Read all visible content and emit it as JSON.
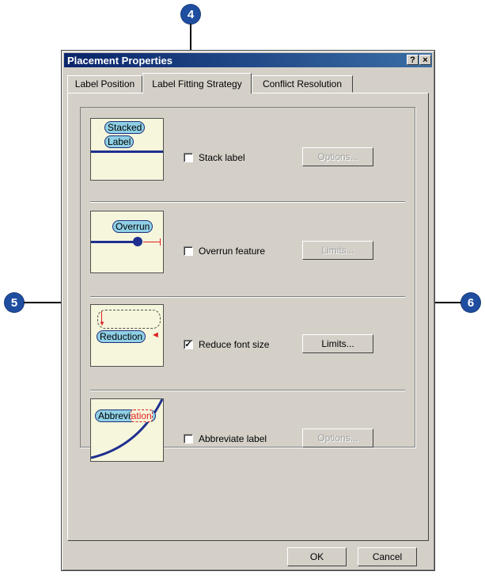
{
  "callouts": [
    "4",
    "5",
    "6"
  ],
  "window": {
    "title": "Placement Properties",
    "help_button": "?",
    "close_button": "×"
  },
  "tabs": [
    {
      "label": "Label Position",
      "active": false
    },
    {
      "label": "Label Fitting Strategy",
      "active": true
    },
    {
      "label": "Conflict Resolution",
      "active": false
    }
  ],
  "strategies": [
    {
      "thumb_text": [
        "Stacked",
        "Label"
      ],
      "checkbox_label": "Stack label",
      "checked": false,
      "button": "Options...",
      "button_enabled": false
    },
    {
      "thumb_text": [
        "Overrun"
      ],
      "checkbox_label": "Overrun feature",
      "checked": false,
      "button": "Limits...",
      "button_enabled": false
    },
    {
      "thumb_text": [
        "Reduction"
      ],
      "checkbox_label": "Reduce font size",
      "checked": true,
      "button": "Limits...",
      "button_enabled": true
    },
    {
      "thumb_text": [
        "Abbrevi",
        "ation"
      ],
      "checkbox_label": "Abbreviate label",
      "checked": false,
      "button": "Options...",
      "button_enabled": false
    }
  ],
  "footer": {
    "ok": "OK",
    "cancel": "Cancel"
  },
  "colors": {
    "callout": "#1f4ea0",
    "titlebar": "#0a246a",
    "thumb_bg": "#f6f6dc",
    "pill": "#8fd0e6",
    "red": "#e02020"
  }
}
